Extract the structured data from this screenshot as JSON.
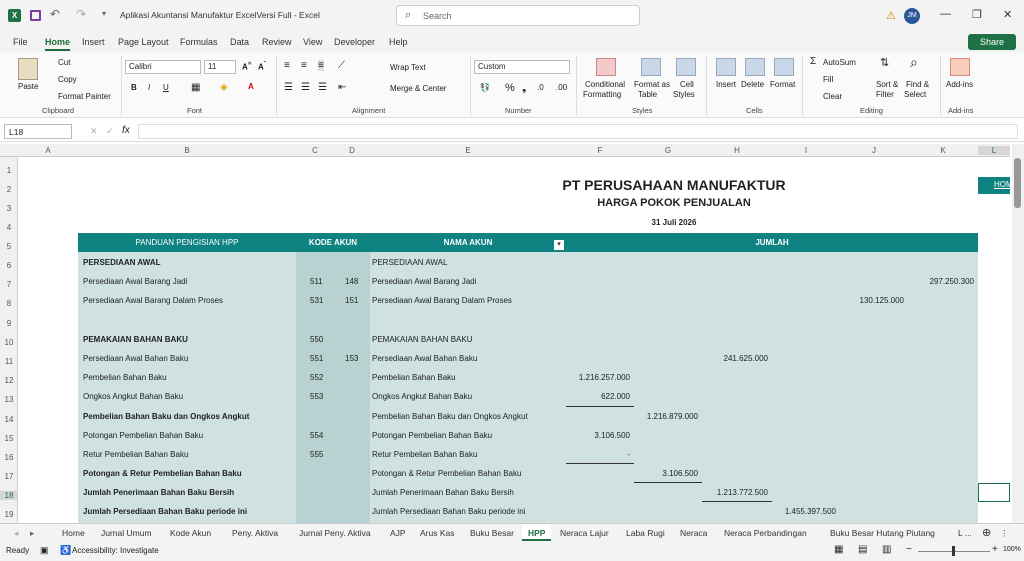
{
  "window": {
    "title": "Aplikasi Akuntansi Manufaktur ExcelVersi Full  -  Excel",
    "search_placeholder": "Search",
    "avatar": "JM"
  },
  "ribbon_tabs": [
    "File",
    "Home",
    "Insert",
    "Page Layout",
    "Formulas",
    "Data",
    "Review",
    "View",
    "Developer",
    "Help"
  ],
  "share": "Share",
  "ribbon": {
    "clipboard": {
      "paste": "Paste",
      "cut": "Cut",
      "copy": "Copy",
      "format_painter": "Format Painter",
      "group": "Clipboard"
    },
    "font": {
      "name": "Calibri",
      "size": "11",
      "group": "Font"
    },
    "alignment": {
      "wrap": "Wrap Text",
      "merge": "Merge & Center",
      "group": "Alignment"
    },
    "number": {
      "format": "Custom",
      "group": "Number"
    },
    "styles": {
      "cond": "Conditional",
      "cond2": "Formatting",
      "fmt_table": "Format as",
      "fmt_table2": "Table",
      "cell": "Cell",
      "cell2": "Styles",
      "group": "Styles"
    },
    "cells": {
      "insert": "Insert",
      "delete": "Delete",
      "format": "Format",
      "group": "Cells"
    },
    "editing": {
      "autosum": "AutoSum",
      "fill": "Fill",
      "clear": "Clear",
      "sort": "Sort &",
      "sort2": "Filter",
      "find": "Find &",
      "find2": "Select",
      "group": "Editing"
    },
    "addins": {
      "label": "Add-ins",
      "group": "Add-ins"
    }
  },
  "namebox": "L18",
  "fx": "fx",
  "columns": [
    "A",
    "B",
    "C",
    "D",
    "E",
    "F",
    "G",
    "H",
    "I",
    "J",
    "K",
    "L"
  ],
  "rows": [
    "1",
    "2",
    "3",
    "4",
    "5",
    "6",
    "7",
    "8",
    "9",
    "10",
    "11",
    "12",
    "13",
    "14",
    "15",
    "16",
    "17",
    "18",
    "19"
  ],
  "sheet": {
    "company": "PT PERUSAHAAN MANUFAKTUR",
    "subtitle": "HARGA POKOK PENJUALAN",
    "date": "31 Juli 2026",
    "home_btn": "HOM",
    "hdr": {
      "panduan": "PANDUAN PENGISIAN HPP",
      "kode": "KODE AKUN",
      "nama": "NAMA AKUN",
      "jumlah": "JUMLAH"
    },
    "b": [
      "PERSEDIAAN AWAL",
      "Persediaan Awal Barang Jadi",
      "Persediaan Awal Barang Dalam Proses",
      "",
      "PEMAKAIAN BAHAN BAKU",
      "Persediaan Awal Bahan Baku",
      "Pembelian Bahan Baku",
      "Ongkos Angkut Bahan Baku",
      "Pembelian Bahan Baku dan Ongkos Angkut",
      "Potongan Pembelian Bahan Baku",
      "Retur Pembelian Bahan Baku",
      "Potongan & Retur Pembelian Bahan Baku",
      "Jumlah Penerimaan Bahan Baku Bersih",
      "Jumlah Persediaan Bahan Baku periode ini"
    ],
    "c": [
      "",
      "511",
      "531",
      "",
      "550",
      "551",
      "552",
      "553",
      "",
      "554",
      "555",
      "",
      "",
      ""
    ],
    "d": [
      "",
      "148",
      "151",
      "",
      "",
      "153",
      "",
      "",
      "",
      "",
      "",
      "",
      "",
      ""
    ],
    "e": [
      "PERSEDIAAN AWAL",
      "Persediaan Awal Barang Jadi",
      "Persediaan Awal Barang Dalam Proses",
      "",
      "PEMAKAIAN BAHAN BAKU",
      "Persediaan Awal Bahan Baku",
      "Pembelian Bahan Baku",
      "Ongkos Angkut Bahan Baku",
      "Pembelian Bahan Baku dan Ongkos Angkut",
      "Potongan Pembelian Bahan Baku",
      "Retur Pembelian Bahan Baku",
      "Potongan & Retur Pembelian Bahan Baku",
      "Jumlah Penerimaan Bahan Baku Bersih",
      "Jumlah Persediaan Bahan Baku periode ini"
    ],
    "f": [
      "",
      "",
      "",
      "",
      "",
      "",
      "1.216.257.000",
      "622.000",
      "",
      "3.106.500",
      "-",
      "",
      "",
      ""
    ],
    "g": [
      "",
      "",
      "",
      "",
      "",
      "",
      "",
      "",
      "1.216.879.000",
      "",
      "",
      "3.106.500",
      "",
      ""
    ],
    "h": [
      "",
      "",
      "",
      "",
      "",
      "241.625.000",
      "",
      "",
      "",
      "",
      "",
      "",
      "1.213.772.500",
      ""
    ],
    "i": [
      "",
      "",
      "",
      "",
      "",
      "",
      "",
      "",
      "",
      "",
      "",
      "",
      "",
      "1.455.397.500"
    ],
    "j": [
      "",
      "",
      "130.125.000",
      "",
      "",
      "",
      "",
      "",
      "",
      "",
      "",
      "",
      "",
      ""
    ],
    "k": [
      "",
      "297.250.300",
      "",
      "",
      "",
      "",
      "",
      "",
      "",
      "",
      "",
      "",
      "",
      ""
    ]
  },
  "sheet_tabs": [
    "Home",
    "Jurnal Umum",
    "Kode Akun",
    "Peny. Aktiva",
    "Jurnal Peny. Aktiva",
    "AJP",
    "Arus Kas",
    "Buku Besar",
    "HPP",
    "Neraca Lajur",
    "Laba Rugi",
    "Neraca",
    "Neraca Perbandingan",
    "Buku Besar Hutang Piutang",
    "L ..."
  ],
  "active_sheet": "HPP",
  "status": {
    "ready": "Ready",
    "accessibility": "Accessibility: Investigate",
    "zoom": "100%"
  },
  "colors": {
    "teal": "#0f8282",
    "panel": "#cfe1e1",
    "excel_green": "#1e7145"
  }
}
